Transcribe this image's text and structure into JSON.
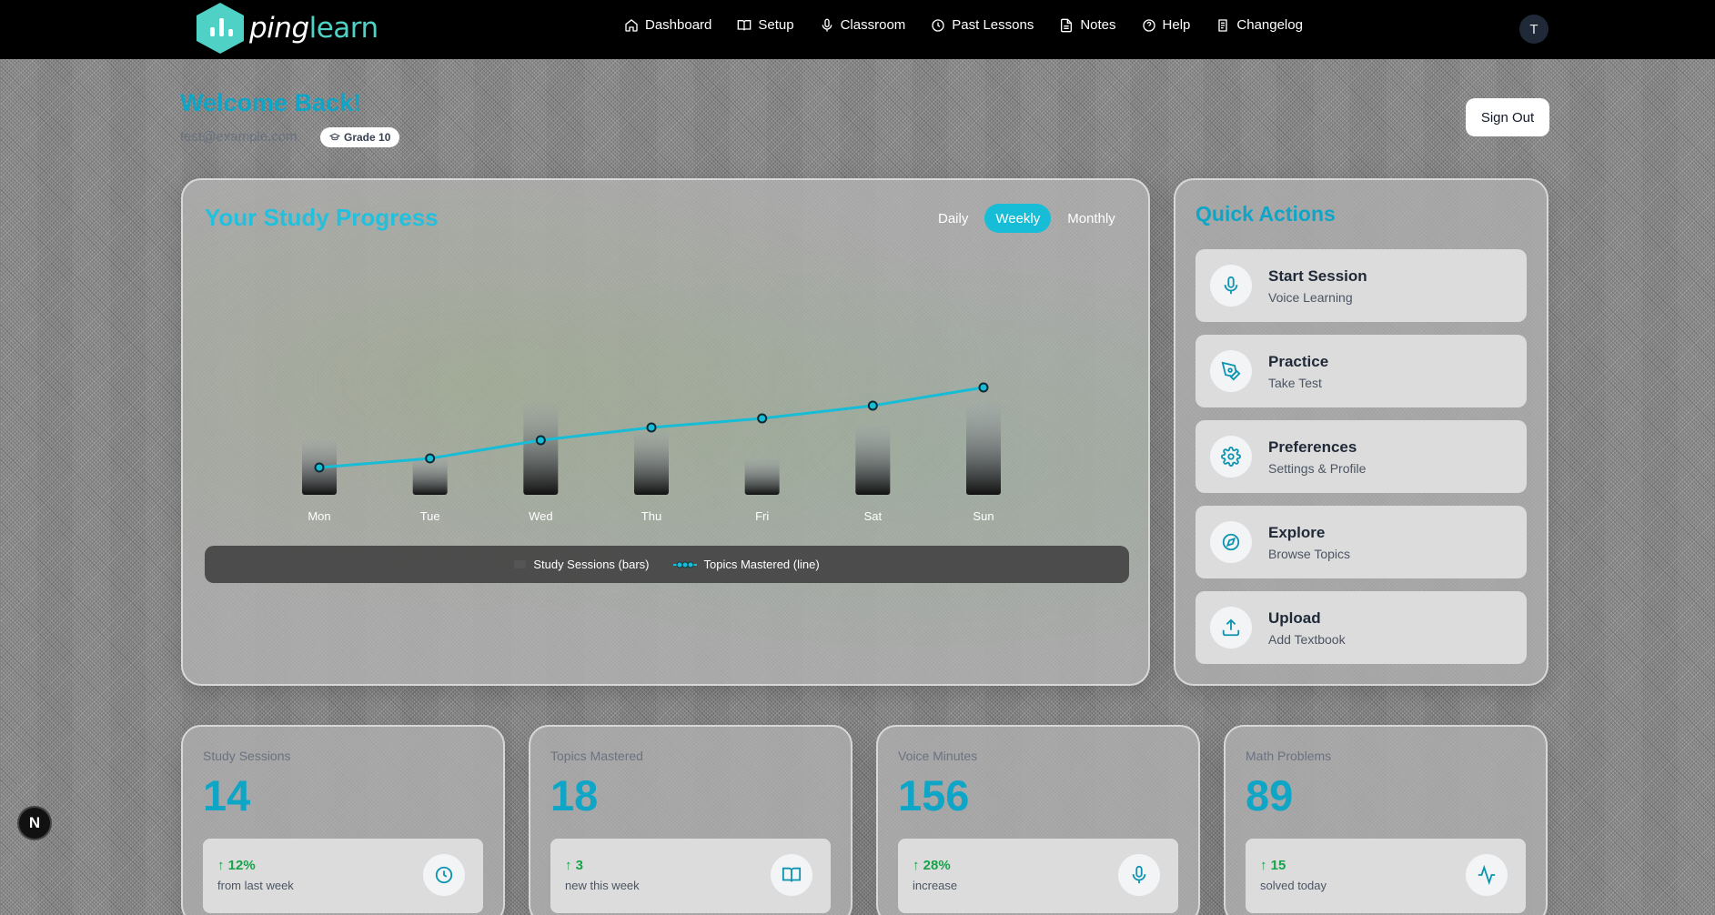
{
  "app": {
    "logo_prefix": "ping",
    "logo_suffix": "learn",
    "user_initial": "T"
  },
  "nav": [
    {
      "label": "Dashboard",
      "icon": "home-icon"
    },
    {
      "label": "Setup",
      "icon": "book-open-icon"
    },
    {
      "label": "Classroom",
      "icon": "microphone-icon"
    },
    {
      "label": "Past Lessons",
      "icon": "clock-icon"
    },
    {
      "label": "Notes",
      "icon": "file-text-icon"
    },
    {
      "label": "Help",
      "icon": "help-circle-icon"
    },
    {
      "label": "Changelog",
      "icon": "changelog-icon"
    }
  ],
  "header": {
    "welcome": "Welcome Back!",
    "email": "test@example.com",
    "grade": "Grade 10",
    "sign_out": "Sign Out"
  },
  "progress": {
    "title": "Your Study Progress",
    "periods": [
      "Daily",
      "Weekly",
      "Monthly"
    ],
    "active_period": "Weekly",
    "legend_bars": "Study Sessions (bars)",
    "legend_line": "Topics Mastered (line)"
  },
  "chart_data": {
    "type": "bar",
    "categories": [
      "Mon",
      "Tue",
      "Wed",
      "Thu",
      "Fri",
      "Sat",
      "Sun"
    ],
    "series": [
      {
        "name": "Study Sessions (bars)",
        "type": "bar",
        "values": [
          3,
          2,
          5,
          3.5,
          2,
          3.8,
          5
        ]
      },
      {
        "name": "Topics Mastered (line)",
        "type": "line",
        "values": [
          1.5,
          2,
          3,
          3.7,
          4.2,
          4.9,
          5.9
        ]
      }
    ],
    "ylim": [
      0,
      10
    ],
    "colors": {
      "line": "#17bcd6",
      "bar_top": "#9ca3af",
      "bar_bottom": "#111111"
    }
  },
  "quick_actions": {
    "title": "Quick Actions",
    "items": [
      {
        "title": "Start Session",
        "subtitle": "Voice Learning",
        "icon": "microphone-icon"
      },
      {
        "title": "Practice",
        "subtitle": "Take Test",
        "icon": "pen-tool-icon"
      },
      {
        "title": "Preferences",
        "subtitle": "Settings & Profile",
        "icon": "gear-icon"
      },
      {
        "title": "Explore",
        "subtitle": "Browse Topics",
        "icon": "compass-icon"
      },
      {
        "title": "Upload",
        "subtitle": "Add Textbook",
        "icon": "upload-icon"
      }
    ]
  },
  "stats": [
    {
      "label": "Study Sessions",
      "value": "14",
      "delta": "12%",
      "note": "from last week",
      "icon": "clock-icon"
    },
    {
      "label": "Topics Mastered",
      "value": "18",
      "delta": "3",
      "note": "new this week",
      "icon": "book-open-icon"
    },
    {
      "label": "Voice Minutes",
      "value": "156",
      "delta": "28%",
      "note": "increase",
      "icon": "microphone-icon"
    },
    {
      "label": "Math Problems",
      "value": "89",
      "delta": "15",
      "note": "solved today",
      "icon": "activity-icon"
    }
  ],
  "dev_badge": "N",
  "colors": {
    "accent": "#0ea5c6",
    "brand": "#4fd1c5",
    "positive": "#16a34a"
  }
}
